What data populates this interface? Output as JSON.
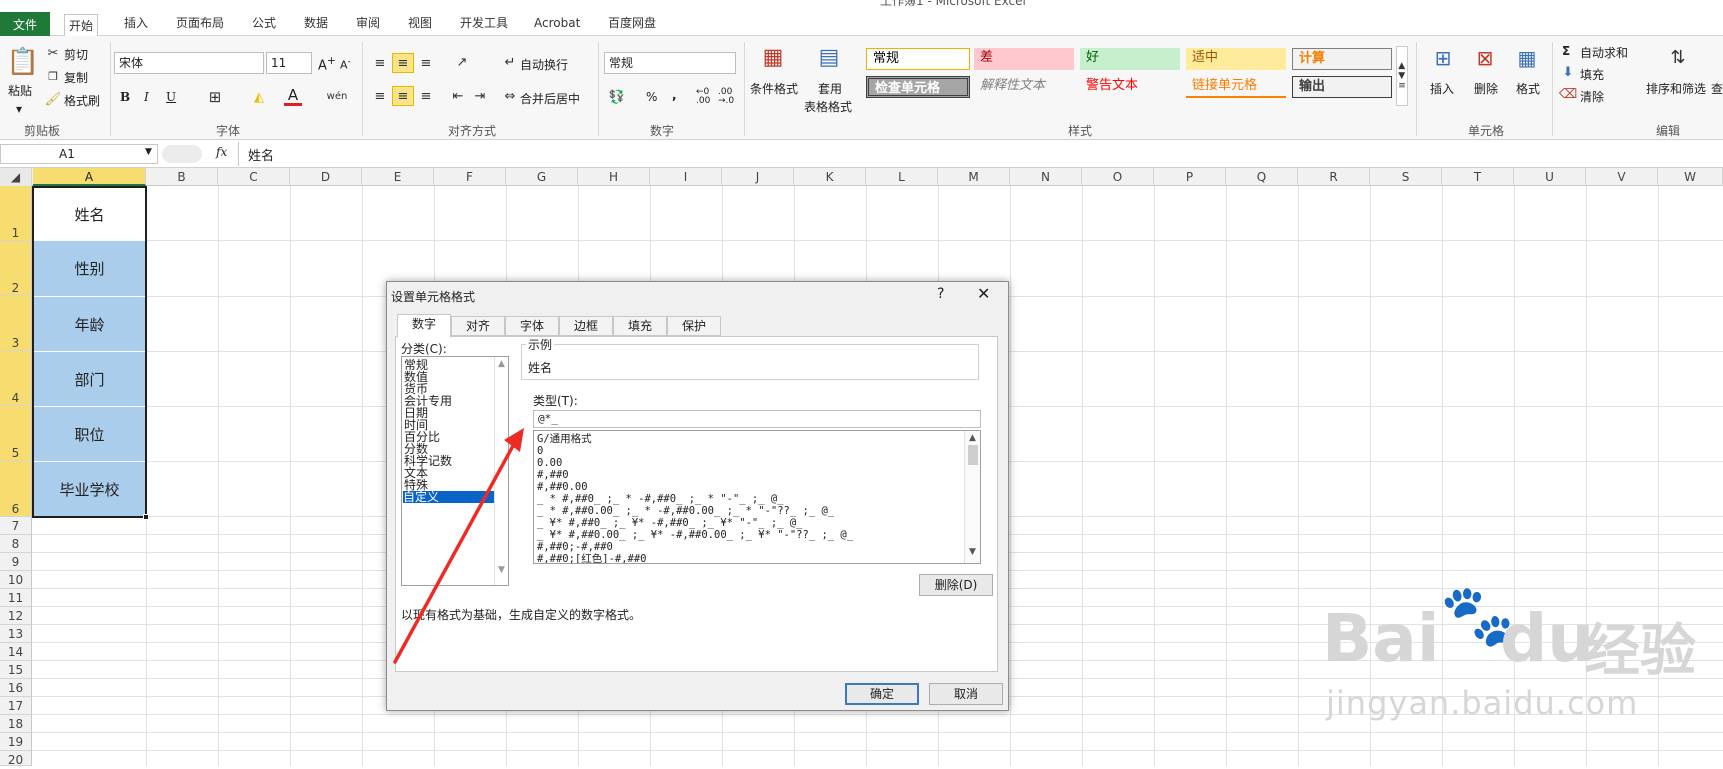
{
  "window": {
    "title": "工作簿1 - Microsoft Excel"
  },
  "tabs": [
    "文件",
    "开始",
    "插入",
    "页面布局",
    "公式",
    "数据",
    "审阅",
    "视图",
    "开发工具",
    "Acrobat",
    "百度网盘"
  ],
  "ribbon": {
    "clipboard": {
      "paste": "粘贴",
      "cut": "剪切",
      "copy": "复制",
      "format_painter": "格式刷",
      "label": "剪贴板"
    },
    "font": {
      "name": "宋体",
      "size": "11",
      "bold": "B",
      "italic": "I",
      "underline": "U",
      "label": "字体"
    },
    "alignment": {
      "wrap": "自动换行",
      "merge": "合并后居中",
      "label": "对齐方式"
    },
    "number": {
      "format": "常规",
      "percent": "%",
      "comma": ",",
      "label": "数字"
    },
    "styles": {
      "conditional": "条件格式",
      "table1": "套用",
      "table2": "表格格式",
      "label": "样式",
      "cells": [
        "常规",
        "差",
        "好",
        "适中",
        "计算",
        "检查单元格",
        "解释性文本",
        "警告文本",
        "链接单元格",
        "输出"
      ]
    },
    "cells": {
      "insert": "插入",
      "delete": "删除",
      "format": "格式",
      "label": "单元格"
    },
    "editing": {
      "autosum": "自动求和",
      "fill": "填充",
      "clear": "清除",
      "sort": "排序和筛选",
      "find": "查",
      "label": "编辑"
    }
  },
  "formula_bar": {
    "name_box": "A1",
    "fx": "fx",
    "content": "姓名"
  },
  "columns": [
    "A",
    "B",
    "C",
    "D",
    "E",
    "F",
    "G",
    "H",
    "I",
    "J",
    "K",
    "L",
    "M",
    "N",
    "O",
    "P",
    "Q",
    "R",
    "S",
    "T",
    "U",
    "V",
    "W"
  ],
  "rows": [
    "1",
    "2",
    "3",
    "4",
    "5",
    "6",
    "7",
    "8",
    "9",
    "10",
    "11",
    "12",
    "13",
    "14",
    "15",
    "16",
    "17",
    "18",
    "19",
    "20"
  ],
  "cells_a": [
    "姓名",
    "性别",
    "年龄",
    "部门",
    "职位",
    "毕业学校"
  ],
  "dialog": {
    "title": "设置单元格格式",
    "help": "?",
    "close": "✕",
    "tabs": [
      "数字",
      "对齐",
      "字体",
      "边框",
      "填充",
      "保护"
    ],
    "category_label": "分类(C):",
    "categories": [
      "常规",
      "数值",
      "货币",
      "会计专用",
      "日期",
      "时间",
      "百分比",
      "分数",
      "科学记数",
      "文本",
      "特殊",
      "自定义"
    ],
    "sample_label": "示例",
    "sample_value": "姓名",
    "type_label": "类型(T):",
    "type_value": "@*_",
    "formats": [
      "G/通用格式",
      "0",
      "0.00",
      "#,##0",
      "#,##0.00",
      "_ * #,##0_ ;_ * -#,##0_ ;_ * \"-\"_ ;_ @_",
      "_ * #,##0.00_ ;_ * -#,##0.00_ ;_ * \"-\"??_ ;_ @_",
      "_ ¥* #,##0_ ;_ ¥* -#,##0_ ;_ ¥* \"-\"_ ;_ @_",
      "_ ¥* #,##0.00_ ;_ ¥* -#,##0.00_ ;_ ¥* \"-\"??_ ;_ @_",
      "#,##0;-#,##0",
      "#,##0;[红色]-#,##0"
    ],
    "delete_btn": "删除(D)",
    "description": "以现有格式为基础，生成自定义的数字格式。",
    "ok": "确定",
    "cancel": "取消"
  },
  "watermark": {
    "brand": "Bai",
    "brand2": "du",
    "cn": "经验",
    "url": "jingyan.baidu.com"
  },
  "colors": {
    "file_tab": "#1f7a3a",
    "cell_fill": "#a9cdea",
    "header_sel": "#f7dc6f",
    "arrow": "#ee2a24",
    "select_blue": "#0a64c8"
  }
}
